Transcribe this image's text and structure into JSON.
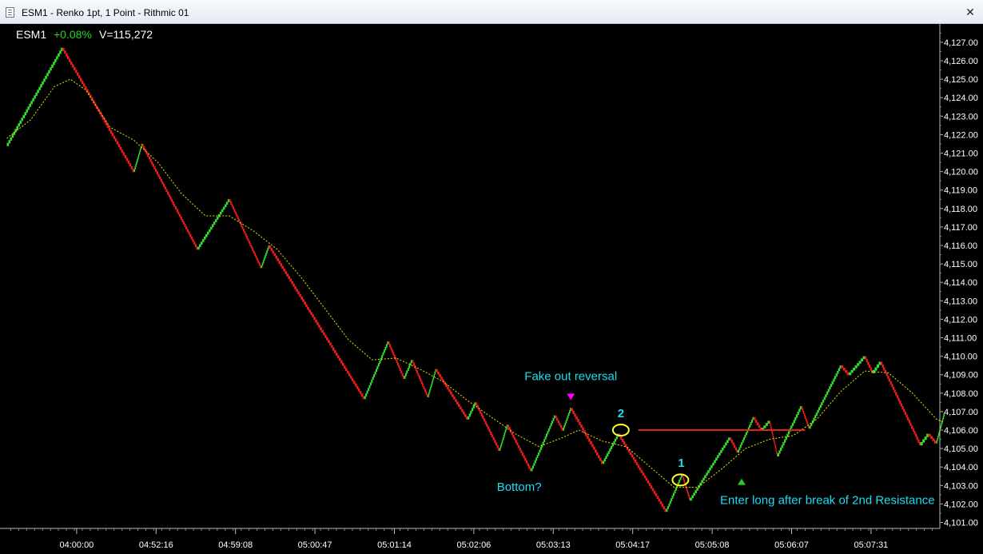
{
  "window": {
    "title": "ESM1 - Renko 1pt, 1 Point - Rithmic 01",
    "close_glyph": "✕"
  },
  "ticker": {
    "symbol": "ESM1",
    "change": "+0.08%",
    "volume": "V=115,272"
  },
  "colors": {
    "background": "#000000",
    "up_brick": "#33e02b",
    "down_brick": "#ee1c1c",
    "moving_average": "#e6e600",
    "annotation_text": "#20dcf0",
    "change_text": "#22d422",
    "fake_out_marker": "#ff00ff",
    "entry_marker": "#22cc22",
    "resistance_line": "#dd2222",
    "circle": "#ffff33",
    "axis_text": "#ffffff"
  },
  "chart_data": {
    "type": "renko",
    "brick_size": 1,
    "brick_unit": "Point",
    "y_range": [
      4100.5,
      4128.3
    ],
    "yticks": [
      {
        "value": 4101,
        "label": "4,101.00"
      },
      {
        "value": 4102,
        "label": "4,102.00"
      },
      {
        "value": 4103,
        "label": "4,103.00"
      },
      {
        "value": 4104,
        "label": "4,104.00"
      },
      {
        "value": 4105,
        "label": "4,105.00"
      },
      {
        "value": 4106,
        "label": "4,106.00"
      },
      {
        "value": 4107,
        "label": "4,107.00"
      },
      {
        "value": 4108,
        "label": "4,108.00"
      },
      {
        "value": 4109,
        "label": "4,109.00"
      },
      {
        "value": 4110,
        "label": "4,110.00"
      },
      {
        "value": 4111,
        "label": "4,111.00"
      },
      {
        "value": 4112,
        "label": "4,112.00"
      },
      {
        "value": 4113,
        "label": "4,113.00"
      },
      {
        "value": 4114,
        "label": "4,114.00"
      },
      {
        "value": 4115,
        "label": "4,115.00"
      },
      {
        "value": 4116,
        "label": "4,116.00"
      },
      {
        "value": 4117,
        "label": "4,117.00"
      },
      {
        "value": 4118,
        "label": "4,118.00"
      },
      {
        "value": 4119,
        "label": "4,119.00"
      },
      {
        "value": 4120,
        "label": "4,120.00"
      },
      {
        "value": 4121,
        "label": "4,121.00"
      },
      {
        "value": 4122,
        "label": "4,122.00"
      },
      {
        "value": 4123,
        "label": "4,123.00"
      },
      {
        "value": 4124,
        "label": "4,124.00"
      },
      {
        "value": 4125,
        "label": "4,125.00"
      },
      {
        "value": 4126,
        "label": "4,126.00"
      },
      {
        "value": 4127,
        "label": "4,127.00"
      }
    ],
    "xticks": [
      {
        "brick": 10,
        "label": "04:00:00"
      },
      {
        "brick": 20,
        "label": "04:52:16"
      },
      {
        "brick": 30,
        "label": "04:59:08"
      },
      {
        "brick": 40,
        "label": "05:00:47"
      },
      {
        "brick": 50,
        "label": "05:01:14"
      },
      {
        "brick": 60,
        "label": "05:02:06"
      },
      {
        "brick": 70,
        "label": "05:03:13"
      },
      {
        "brick": 80,
        "label": "05:04:17"
      },
      {
        "brick": 90,
        "label": "05:05:08"
      },
      {
        "brick": 100,
        "label": "05:06:07"
      },
      {
        "brick": 110,
        "label": "05:07:31"
      }
    ],
    "x_range": [
      0,
      118
    ],
    "swing_points": [
      {
        "brick": 0,
        "price": 4121.4
      },
      {
        "brick": 7,
        "price": 4126.7
      },
      {
        "brick": 16,
        "price": 4120.0
      },
      {
        "brick": 17,
        "price": 4121.5
      },
      {
        "brick": 24,
        "price": 4115.8
      },
      {
        "brick": 28,
        "price": 4118.5
      },
      {
        "brick": 32,
        "price": 4114.8
      },
      {
        "brick": 33,
        "price": 4116.0
      },
      {
        "brick": 45,
        "price": 4107.7
      },
      {
        "brick": 48,
        "price": 4110.8
      },
      {
        "brick": 50,
        "price": 4108.8
      },
      {
        "brick": 51,
        "price": 4109.8
      },
      {
        "brick": 53,
        "price": 4107.8
      },
      {
        "brick": 54,
        "price": 4109.3
      },
      {
        "brick": 58,
        "price": 4106.6
      },
      {
        "brick": 59,
        "price": 4107.5
      },
      {
        "brick": 62,
        "price": 4104.9
      },
      {
        "brick": 63,
        "price": 4106.3
      },
      {
        "brick": 66,
        "price": 4103.8
      },
      {
        "brick": 69,
        "price": 4106.8
      },
      {
        "brick": 70,
        "price": 4106.0
      },
      {
        "brick": 71,
        "price": 4107.2
      },
      {
        "brick": 75,
        "price": 4104.2
      },
      {
        "brick": 77,
        "price": 4105.8
      },
      {
        "brick": 83,
        "price": 4101.6
      },
      {
        "brick": 85,
        "price": 4103.6
      },
      {
        "brick": 86,
        "price": 4102.2
      },
      {
        "brick": 91,
        "price": 4105.6
      },
      {
        "brick": 92,
        "price": 4104.8
      },
      {
        "brick": 94,
        "price": 4106.7
      },
      {
        "brick": 95,
        "price": 4106.0
      },
      {
        "brick": 96,
        "price": 4106.5
      },
      {
        "brick": 97,
        "price": 4104.6
      },
      {
        "brick": 100,
        "price": 4107.3
      },
      {
        "brick": 101,
        "price": 4106.1
      },
      {
        "brick": 105,
        "price": 4109.5
      },
      {
        "brick": 106,
        "price": 4109.0
      },
      {
        "brick": 108,
        "price": 4110.0
      },
      {
        "brick": 109,
        "price": 4109.1
      },
      {
        "brick": 110,
        "price": 4109.7
      },
      {
        "brick": 115,
        "price": 4105.2
      },
      {
        "brick": 116,
        "price": 4105.8
      },
      {
        "brick": 117,
        "price": 4105.3
      },
      {
        "brick": 118,
        "price": 4106.9
      }
    ],
    "moving_average": [
      {
        "brick": 0,
        "price": 4121.8
      },
      {
        "brick": 3,
        "price": 4122.8
      },
      {
        "brick": 6,
        "price": 4124.6
      },
      {
        "brick": 8,
        "price": 4125.0
      },
      {
        "brick": 10,
        "price": 4124.4
      },
      {
        "brick": 13,
        "price": 4122.4
      },
      {
        "brick": 16,
        "price": 4121.7
      },
      {
        "brick": 19,
        "price": 4120.5
      },
      {
        "brick": 22,
        "price": 4118.8
      },
      {
        "brick": 25,
        "price": 4117.6
      },
      {
        "brick": 28,
        "price": 4117.6
      },
      {
        "brick": 31,
        "price": 4116.8
      },
      {
        "brick": 34,
        "price": 4115.8
      },
      {
        "brick": 37,
        "price": 4114.3
      },
      {
        "brick": 40,
        "price": 4112.6
      },
      {
        "brick": 43,
        "price": 4110.9
      },
      {
        "brick": 46,
        "price": 4109.8
      },
      {
        "brick": 49,
        "price": 4109.9
      },
      {
        "brick": 52,
        "price": 4109.3
      },
      {
        "brick": 55,
        "price": 4108.6
      },
      {
        "brick": 58,
        "price": 4107.6
      },
      {
        "brick": 61,
        "price": 4106.7
      },
      {
        "brick": 64,
        "price": 4105.8
      },
      {
        "brick": 67,
        "price": 4105.1
      },
      {
        "brick": 70,
        "price": 4105.6
      },
      {
        "brick": 72,
        "price": 4106.0
      },
      {
        "brick": 75,
        "price": 4105.4
      },
      {
        "brick": 78,
        "price": 4105.1
      },
      {
        "brick": 81,
        "price": 4104.0
      },
      {
        "brick": 84,
        "price": 4102.9
      },
      {
        "brick": 87,
        "price": 4102.9
      },
      {
        "brick": 90,
        "price": 4103.9
      },
      {
        "brick": 93,
        "price": 4105.0
      },
      {
        "brick": 96,
        "price": 4105.5
      },
      {
        "brick": 99,
        "price": 4105.7
      },
      {
        "brick": 102,
        "price": 4106.6
      },
      {
        "brick": 105,
        "price": 4108.1
      },
      {
        "brick": 108,
        "price": 4109.2
      },
      {
        "brick": 111,
        "price": 4109.1
      },
      {
        "brick": 114,
        "price": 4108.0
      },
      {
        "brick": 117,
        "price": 4106.6
      },
      {
        "brick": 118,
        "price": 4106.4
      }
    ],
    "annotations": [
      {
        "text": "Fake out reversal",
        "brick": 71,
        "price": 4108.7
      },
      {
        "text": "Bottom?",
        "brick": 64.5,
        "price": 4102.7
      },
      {
        "text": "2",
        "brick": 77.3,
        "price": 4106.7
      },
      {
        "text": "1",
        "brick": 84.9,
        "price": 4104.0
      },
      {
        "text": "Enter long after break of 2nd Resistance",
        "brick": 103.3,
        "price": 4102.0
      }
    ],
    "markers": [
      {
        "shape": "down-triangle",
        "brick": 71,
        "price": 4107.8,
        "color": "fake_out_marker"
      },
      {
        "shape": "up-triangle",
        "brick": 92.5,
        "price": 4103.2,
        "color": "entry_marker"
      }
    ],
    "circles": [
      {
        "brick": 77.3,
        "price": 4106.0
      },
      {
        "brick": 84.8,
        "price": 4103.3
      }
    ],
    "resistance_line": {
      "brick_start": 79.5,
      "brick_end": 100.5,
      "price": 4106.0
    }
  }
}
